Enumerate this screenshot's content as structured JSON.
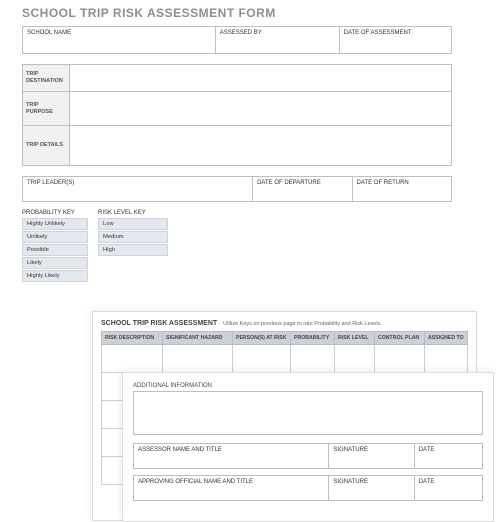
{
  "title": "SCHOOL TRIP RISK ASSESSMENT FORM",
  "header": {
    "school_name_label": "SCHOOL NAME",
    "assessed_by_label": "ASSESSED BY",
    "date_assessment_label": "DATE OF ASSESSMENT"
  },
  "trip": {
    "destination_label": "TRIP DESTINATION",
    "purpose_label": "TRIP PURPOSE",
    "details_label": "TRIP DETAILS"
  },
  "leader": {
    "leaders_label": "TRIP LEADER(S)",
    "departure_label": "DATE OF DEPARTURE",
    "return_label": "DATE OF RETURN"
  },
  "keys": {
    "probability_title": "PROBABILITY KEY",
    "probability": [
      "Highly Unlikely",
      "Unlikely",
      "Possible",
      "Likely",
      "Highly Likely"
    ],
    "risk_title": "RISK LEVEL KEY",
    "risk": [
      "Low",
      "Medium",
      "High"
    ]
  },
  "page2": {
    "title": "SCHOOL TRIP RISK ASSESSMENT",
    "subtitle": "Utilize Keys on previous page to rate Probability and Risk Levels.",
    "columns": [
      "RISK DESCRIPTION",
      "SIGNIFICANT HAZARD",
      "PERSON(S) AT RISK",
      "PROBABILITY",
      "RISK LEVEL",
      "CONTROL PLAN",
      "ASSIGNED TO"
    ]
  },
  "page3": {
    "additional_label": "ADDITIONAL INFORMATION",
    "assessor_label": "ASSESSOR NAME AND TITLE",
    "approver_label": "APPROVING OFFICIAL NAME AND TITLE",
    "signature_label": "SIGNATURE",
    "date_label": "DATE"
  }
}
